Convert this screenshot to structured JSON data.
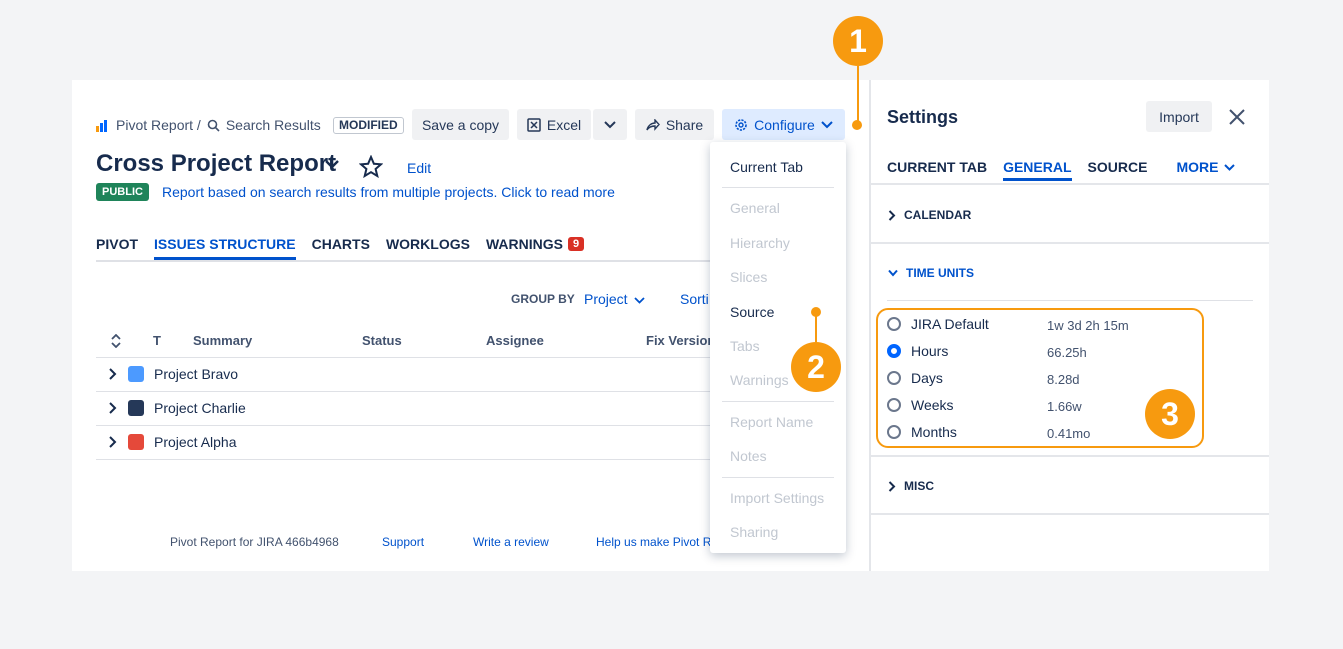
{
  "breadcrumb": {
    "app": "Pivot Report /",
    "search": "Search Results"
  },
  "toolbar": {
    "modified": "MODIFIED",
    "save_copy": "Save a copy",
    "excel": "Excel",
    "share": "Share",
    "configure": "Configure"
  },
  "report": {
    "title": "Cross Project Report",
    "edit": "Edit",
    "public_badge": "PUBLIC",
    "description": "Report based on search results from multiple projects. Click to read more"
  },
  "tabs": [
    {
      "label": "PIVOT"
    },
    {
      "label": "ISSUES STRUCTURE"
    },
    {
      "label": "CHARTS"
    },
    {
      "label": "WORKLOGS"
    },
    {
      "label": "WARNINGS",
      "count": "9"
    }
  ],
  "groupby": {
    "label": "GROUP BY",
    "value": "Project",
    "sort": "Sorti"
  },
  "table": {
    "columns": [
      "T",
      "Summary",
      "Status",
      "Assignee",
      "Fix Version"
    ],
    "rows": [
      {
        "name": "Project Bravo",
        "icon": "notepad-icon",
        "color": "#4c9aff"
      },
      {
        "name": "Project Charlie",
        "icon": "rocket-icon",
        "color": "#253858"
      },
      {
        "name": "Project Alpha",
        "icon": "robot-icon",
        "color": "#e5493a"
      }
    ]
  },
  "footer": {
    "version": "Pivot Report for JIRA 466b4968",
    "support": "Support",
    "review": "Write a review",
    "help": "Help us make Pivot Re"
  },
  "configure_menu": {
    "current_tab": "Current Tab",
    "items_a": [
      "General",
      "Hierarchy",
      "Slices",
      "Source",
      "Tabs",
      "Warnings"
    ],
    "items_b": [
      "Report Name",
      "Notes"
    ],
    "items_c": [
      "Import Settings",
      "Sharing"
    ]
  },
  "settings": {
    "title": "Settings",
    "import": "Import",
    "tabs": [
      "CURRENT TAB",
      "GENERAL",
      "SOURCE",
      "MORE"
    ],
    "sections": {
      "calendar": "CALENDAR",
      "time_units": "TIME UNITS",
      "misc": "MISC"
    },
    "time_units": [
      {
        "label": "JIRA Default",
        "value": "1w 3d 2h 15m",
        "checked": false
      },
      {
        "label": "Hours",
        "value": "66.25h",
        "checked": true
      },
      {
        "label": "Days",
        "value": "8.28d",
        "checked": false
      },
      {
        "label": "Weeks",
        "value": "1.66w",
        "checked": false
      },
      {
        "label": "Months",
        "value": "0.41mo",
        "checked": false
      }
    ]
  },
  "annotations": [
    "1",
    "2",
    "3"
  ],
  "colors": {
    "accent": "#0052cc",
    "annotation": "#f79a0f",
    "public": "#1f845a"
  }
}
